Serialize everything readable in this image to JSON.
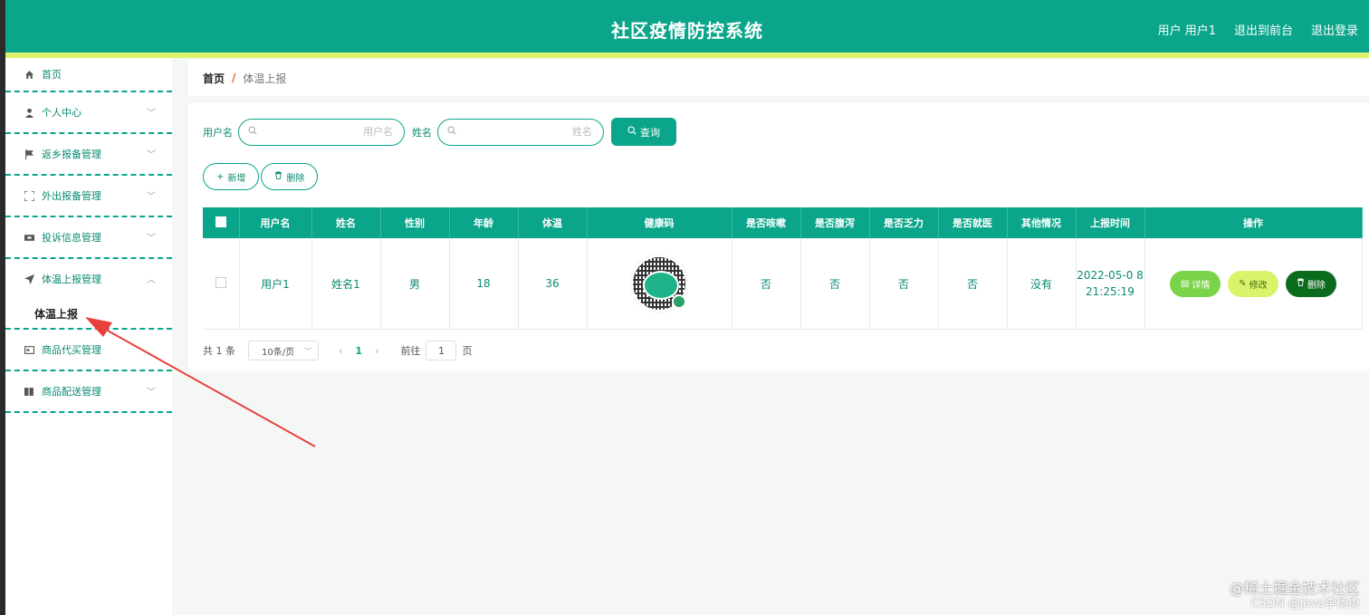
{
  "header": {
    "title": "社区疫情防控系统",
    "user_label": "用户 用户1",
    "to_front": "退出到前台",
    "logout": "退出登录"
  },
  "sidebar": {
    "items": [
      {
        "label": "首页",
        "icon": "home-icon"
      },
      {
        "label": "个人中心",
        "icon": "user-icon"
      },
      {
        "label": "返乡报备管理",
        "icon": "flag-icon"
      },
      {
        "label": "外出报备管理",
        "icon": "expand-icon"
      },
      {
        "label": "投诉信息管理",
        "icon": "ticket-icon"
      },
      {
        "label": "体温上报管理",
        "icon": "send-icon"
      },
      {
        "label": "商品代买管理",
        "icon": "card-icon"
      },
      {
        "label": "商品配送管理",
        "icon": "book-icon"
      }
    ],
    "submenu": "体温上报"
  },
  "breadcrumb": {
    "home": "首页",
    "separator": "/",
    "current": "体温上报"
  },
  "search": {
    "username_label": "用户名",
    "username_placeholder": "用户名",
    "name_label": "姓名",
    "name_placeholder": "姓名",
    "query_button": "查询"
  },
  "actions": {
    "add": "新增",
    "delete": "删除"
  },
  "table": {
    "headers": [
      "用户名",
      "姓名",
      "性别",
      "年龄",
      "体温",
      "健康码",
      "是否咳嗽",
      "是否腹泻",
      "是否乏力",
      "是否就医",
      "其他情况",
      "上报时间",
      "操作"
    ],
    "rows": [
      {
        "username": "用户1",
        "name": "姓名1",
        "gender": "男",
        "age": "18",
        "temperature": "36",
        "cough": "否",
        "diarrhea": "否",
        "fatigue": "否",
        "medical": "否",
        "other": "没有",
        "time": "2022-05-0 8 21:25:19"
      }
    ],
    "op_detail": "详情",
    "op_edit": "修改",
    "op_delete": "删除"
  },
  "pagination": {
    "total": "共 1 条",
    "page_size": "10条/页",
    "current_page": "1",
    "goto_label": "前往",
    "goto_value": "1",
    "page_suffix": "页"
  },
  "watermark": {
    "line1": "@稀土掘金技术社区",
    "line2": "CSDN @java李杨勇"
  },
  "colors": {
    "primary": "#0aa58a",
    "accent_yellow": "#d9f36a",
    "detail_green": "#7ad44a",
    "delete_dark": "#0b6b1c"
  }
}
